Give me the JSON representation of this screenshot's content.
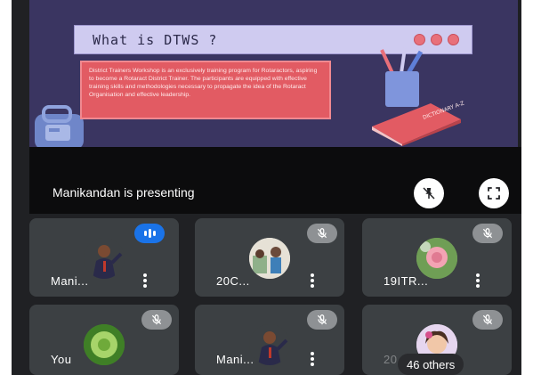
{
  "slide": {
    "title": "What is DTWS ?",
    "body": "District Trainers Workshop is an exclusively training program for Rotaractors, aspiring to become a Rotaract District Trainer. The participants are equipped with effective training skills and methodologies necessary to propagate the idea of the Rotaract Organisation and effective leadership.",
    "book_label": "DICTIONARY A-Z"
  },
  "presenter": {
    "text": "Manikandan is presenting"
  },
  "participants": [
    {
      "name": "Mani...",
      "status": "speaking"
    },
    {
      "name": "20C...",
      "status": "muted"
    },
    {
      "name": "19ITR...",
      "status": "muted"
    },
    {
      "name": "You",
      "status": "muted"
    },
    {
      "name": "Mani...",
      "status": "muted"
    },
    {
      "name": "20",
      "status": "muted"
    }
  ],
  "others": {
    "label": "46 others"
  },
  "colors": {
    "tile": "#3c4043",
    "speak": "#1a73e8",
    "mute": "#8e9194",
    "slide_bg": "#3a3561",
    "card": "#e25b63"
  },
  "icons": [
    "pin-off-icon",
    "fullscreen-icon",
    "mic-off-icon",
    "more-vert-icon",
    "audio-bars-icon"
  ]
}
